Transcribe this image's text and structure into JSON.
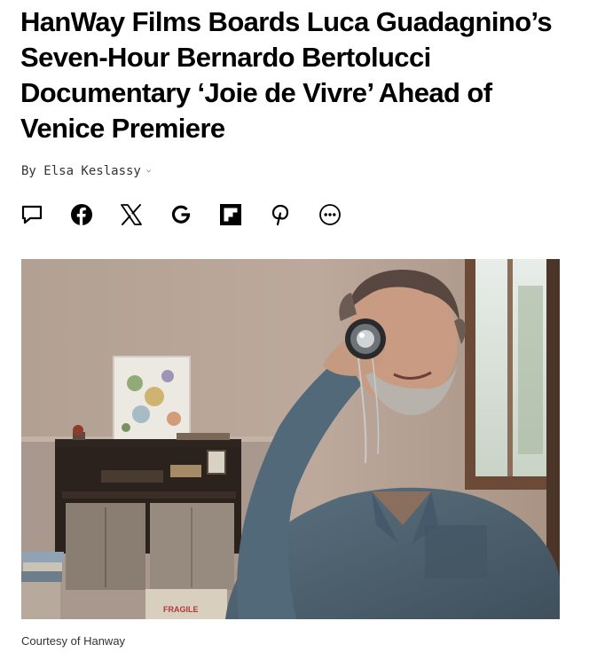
{
  "article": {
    "headline": "HanWay Films Boards Luca Guadagnino’s Seven-Hour Bernardo Bertolucci Documentary ‘Joie de Vivre’ Ahead of Venice Premiere",
    "byline": "By Elsa Keslassy",
    "byline_dropdown_icon": "chevron-down-icon"
  },
  "share": {
    "icons": [
      "comment-icon",
      "facebook-icon",
      "x-icon",
      "google-icon",
      "flipboard-icon",
      "pinterest-icon",
      "more-icon"
    ]
  },
  "photo": {
    "box_label": "FRAGILE"
  },
  "caption": "Courtesy of Hanway",
  "colors": {
    "text": "#000000",
    "byline": "#333333",
    "wall": "#b8a69a",
    "shirt": "#4f6472"
  }
}
